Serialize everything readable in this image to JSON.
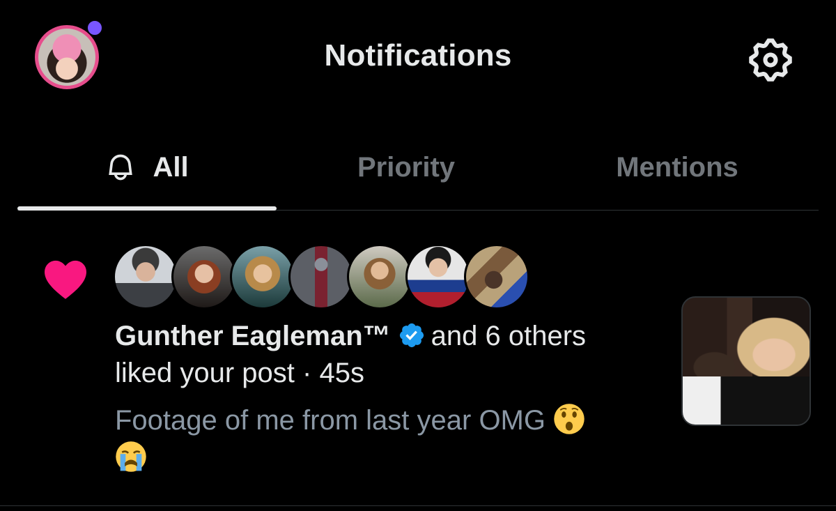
{
  "header": {
    "title": "Notifications",
    "profile_avatar": "profile-photo",
    "settings_icon": "gear-icon",
    "unread_dot_color": "#7856ff"
  },
  "tabs": [
    {
      "label": "All",
      "icon": "bell-icon",
      "active": true
    },
    {
      "label": "Priority",
      "active": false
    },
    {
      "label": "Mentions",
      "active": false
    }
  ],
  "notification": {
    "type_icon": "heart-icon",
    "type_color": "#f91880",
    "liker_avatars": [
      "avatar-1",
      "avatar-2",
      "avatar-3",
      "avatar-4",
      "avatar-5",
      "avatar-6",
      "avatar-7"
    ],
    "user_name": "Gunther Eagleman™",
    "verified_icon": "verified-badge-icon",
    "others": "and 6 others",
    "action": "liked your post",
    "separator": "·",
    "time": "45s",
    "post_text": "Footage of me from last year OMG",
    "post_emojis": [
      "astonished-face-emoji",
      "crying-face-emoji"
    ],
    "thumbnail": "post-thumbnail"
  },
  "colors": {
    "background": "#000000",
    "primary_text": "#e7e9ea",
    "secondary_text": "#71767b",
    "verified_blue": "#1d9bf0",
    "profile_ring": "#e64d8c"
  }
}
